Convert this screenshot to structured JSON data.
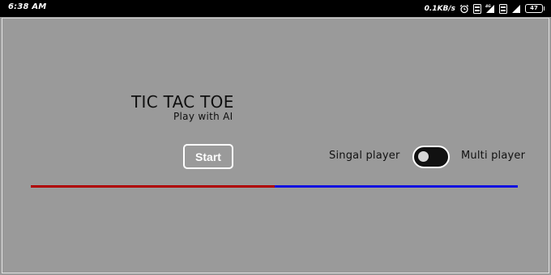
{
  "status_bar": {
    "time": "6:38 AM",
    "net_speed": "0.1KB/s",
    "battery": "47",
    "icons": [
      "alarm-icon",
      "volte-icon",
      "signal-4g-icon",
      "volte-icon",
      "signal-icon",
      "battery-icon"
    ]
  },
  "game": {
    "title": "TIC TAC TOE",
    "subtitle": "Play with AI",
    "start_label": "Start",
    "mode_single": "Singal player",
    "mode_multi": "Multi player",
    "toggle_on": false
  },
  "colors": {
    "background": "#9a9a9a",
    "line_left": "#b00000",
    "line_right": "#1010e0",
    "button_border": "#ffffff",
    "toggle_track": "#111111"
  }
}
